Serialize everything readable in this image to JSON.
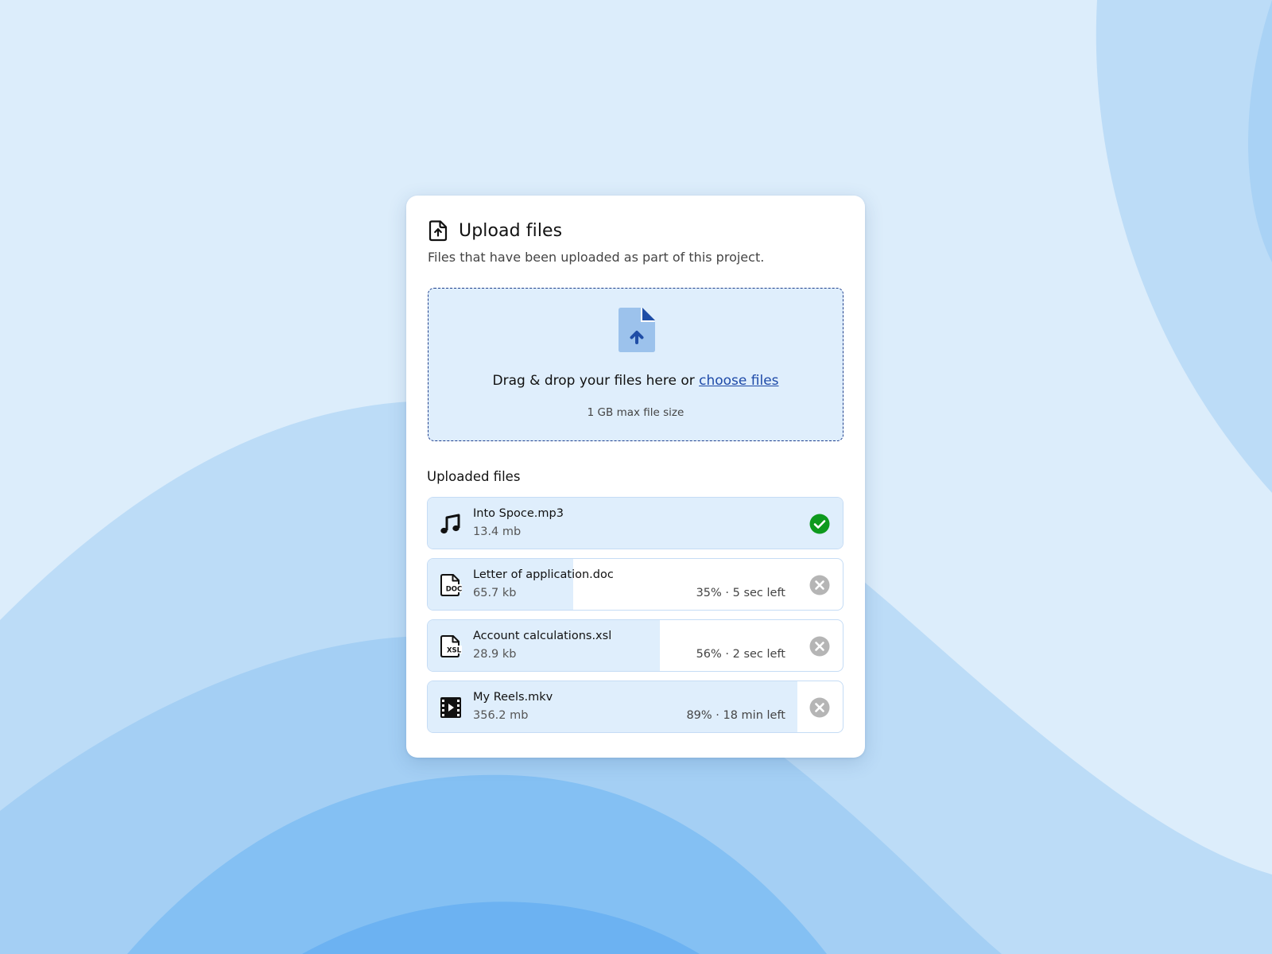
{
  "colors": {
    "accent": "#1e4aa8",
    "dropzone_bg": "#dfeefc",
    "dropzone_border": "#1e3f8c",
    "success": "#0e9a1e",
    "cancel": "#b5b5b5"
  },
  "header": {
    "icon": "file-upload-icon",
    "title": "Upload files",
    "subtitle": "Files that have been uploaded as part of this project."
  },
  "dropzone": {
    "icon": "file-upload-icon",
    "text": "Drag & drop your files here or ",
    "link_text": "choose files",
    "hint": "1 GB max file size"
  },
  "uploaded": {
    "title": "Uploaded files",
    "files": [
      {
        "icon": "music-note-icon",
        "name": "Into Spoce.mp3",
        "size": "13.4 mb",
        "progress_text": "",
        "progress": 1.0,
        "status": "complete",
        "status_icon": "check-circle-icon"
      },
      {
        "icon": "doc-file-icon",
        "name": "Letter of application.doc",
        "size": "65.7 kb",
        "progress_text": "35% · 5 sec left",
        "progress": 0.35,
        "status": "uploading",
        "status_icon": "close-circle-icon"
      },
      {
        "icon": "xsl-file-icon",
        "name": "Account calculations.xsl",
        "size": "28.9 kb",
        "progress_text": "56% · 2 sec left",
        "progress": 0.56,
        "status": "uploading",
        "status_icon": "close-circle-icon"
      },
      {
        "icon": "film-icon",
        "name": "My Reels.mkv",
        "size": "356.2 mb",
        "progress_text": "89% · 18 min left",
        "progress": 0.89,
        "status": "uploading",
        "status_icon": "close-circle-icon"
      }
    ]
  }
}
